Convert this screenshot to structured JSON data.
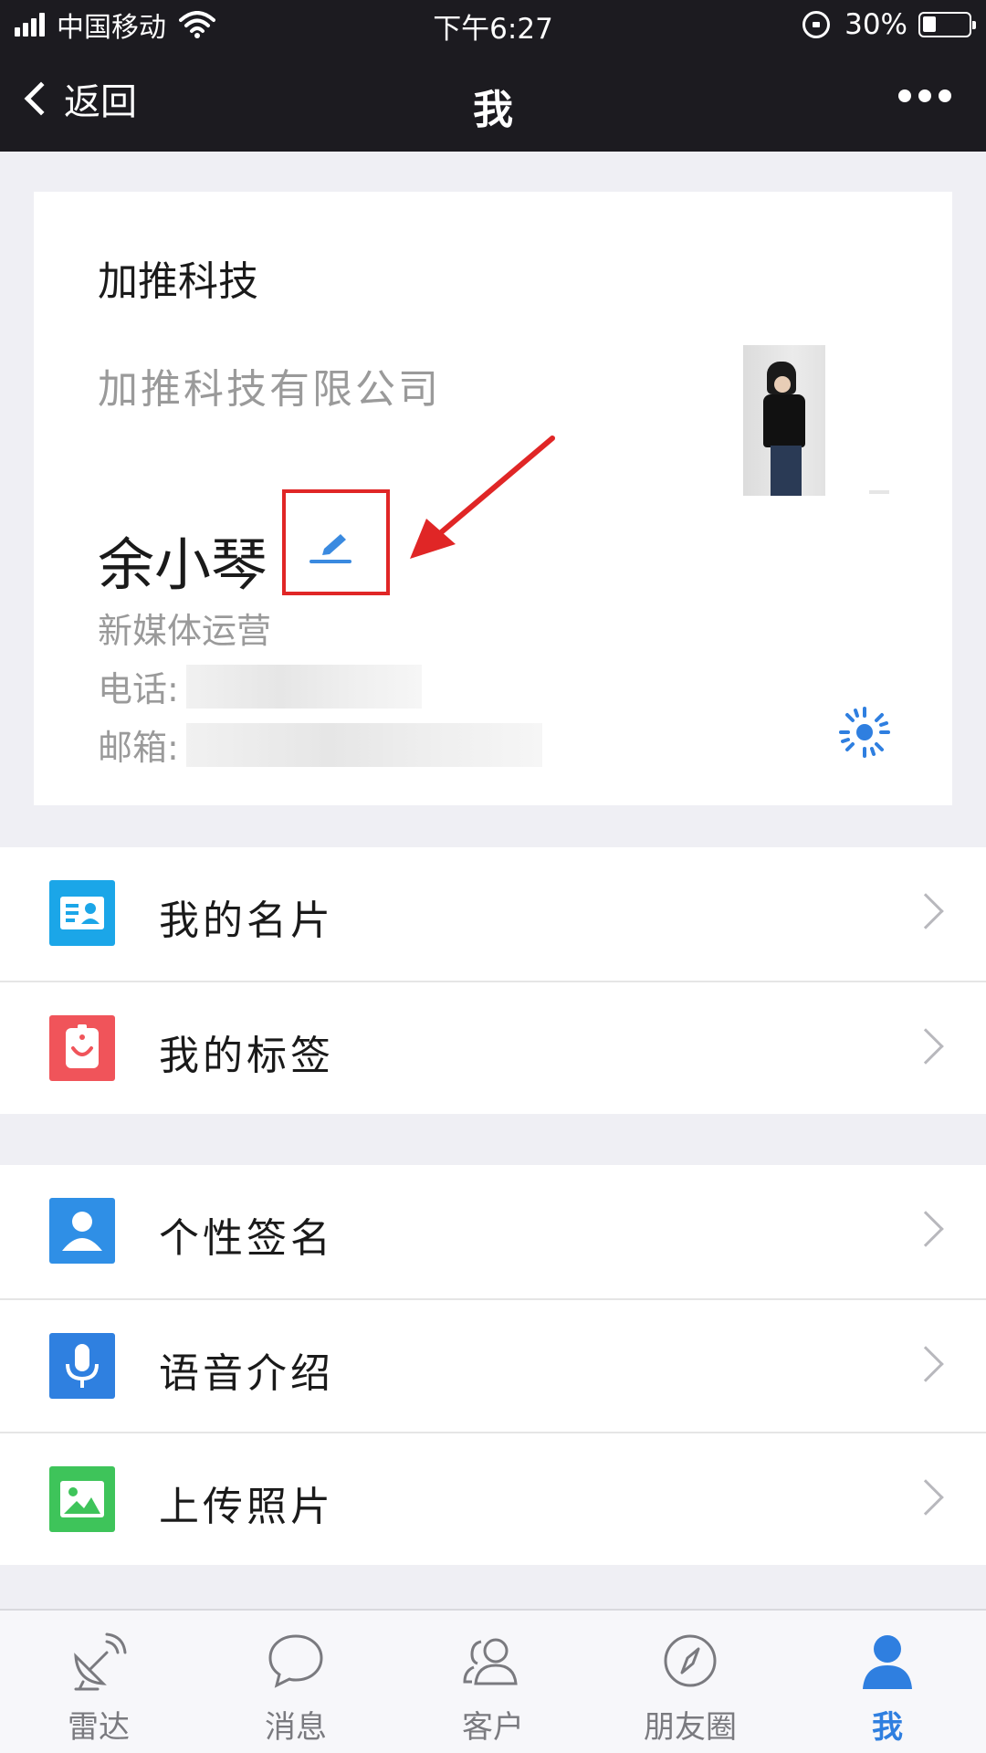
{
  "status_bar": {
    "carrier": "中国移动",
    "time": "下午6:27",
    "battery_percent": "30%",
    "battery_level": 0.3
  },
  "nav": {
    "back_label": "返回",
    "title": "我",
    "more_icon": "more-dots-icon"
  },
  "profile": {
    "org_short": "加推科技",
    "org_full": "加推科技有限公司",
    "name": "余小琴",
    "job_title": "新媒体运营",
    "phone_label": "电话:",
    "email_label": "邮箱:",
    "edit_icon": "pencil-icon",
    "qr_icon": "radar-code-icon",
    "highlight_color": "#e02626"
  },
  "menu_group_1": [
    {
      "label": "我的名片",
      "icon": "business-card-icon",
      "color": "#1ba6e8"
    },
    {
      "label": "我的标签",
      "icon": "tag-bag-icon",
      "color": "#f0545a"
    }
  ],
  "menu_group_2": [
    {
      "label": "个性签名",
      "icon": "user-icon",
      "color": "#2f8fe6"
    },
    {
      "label": "语音介绍",
      "icon": "microphone-icon",
      "color": "#2f80e0"
    },
    {
      "label": "上传照片",
      "icon": "image-icon",
      "color": "#3ec45a"
    }
  ],
  "tabbar": {
    "items": [
      {
        "label": "雷达",
        "icon": "radar-dish-icon",
        "active": false
      },
      {
        "label": "消息",
        "icon": "chat-bubble-icon",
        "active": false
      },
      {
        "label": "客户",
        "icon": "customers-icon",
        "active": false
      },
      {
        "label": "朋友圈",
        "icon": "compass-icon",
        "active": false
      },
      {
        "label": "我",
        "icon": "person-icon",
        "active": true
      }
    ],
    "active_color": "#2f7fe0",
    "inactive_color": "#7a7a7f"
  }
}
